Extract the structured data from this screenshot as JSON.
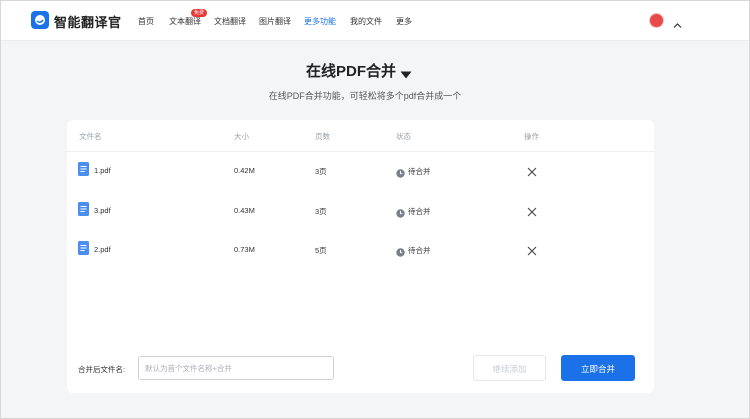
{
  "header": {
    "brand": "智能翻译官",
    "nav": [
      {
        "label": "首页"
      },
      {
        "label": "文本翻译"
      },
      {
        "label": "文档翻译"
      },
      {
        "label": "图片翻译"
      },
      {
        "label": "更多功能"
      },
      {
        "label": "我的文件"
      },
      {
        "label": "更多"
      }
    ],
    "badge": "免费",
    "active_nav": "更多功能"
  },
  "page": {
    "title": "在线PDF合并",
    "subtitle": "在线PDF合并功能，可轻松将多个pdf合并成一个"
  },
  "table": {
    "columns": [
      "文件名",
      "大小",
      "页数",
      "状态",
      "操作"
    ],
    "rows": [
      {
        "name": "1.pdf",
        "size": "0.42M",
        "pages": "3页",
        "status": "待合并"
      },
      {
        "name": "3.pdf",
        "size": "0.43M",
        "pages": "3页",
        "status": "待合并"
      },
      {
        "name": "2.pdf",
        "size": "0.73M",
        "pages": "5页",
        "status": "待合并"
      }
    ]
  },
  "footer": {
    "name_label": "合并后文件名:",
    "name_placeholder": "默认为首个文件名称+合并",
    "continue_label": "继续添加",
    "merge_label": "立即合并"
  },
  "colors": {
    "accent": "#1b72e8",
    "badge": "#e53935",
    "background": "#f4f5f7"
  },
  "icons": {
    "logo": "translator-logo-icon",
    "file": "document-icon",
    "status": "clock-icon",
    "remove": "close-icon",
    "dropdown": "caret-down-icon"
  }
}
